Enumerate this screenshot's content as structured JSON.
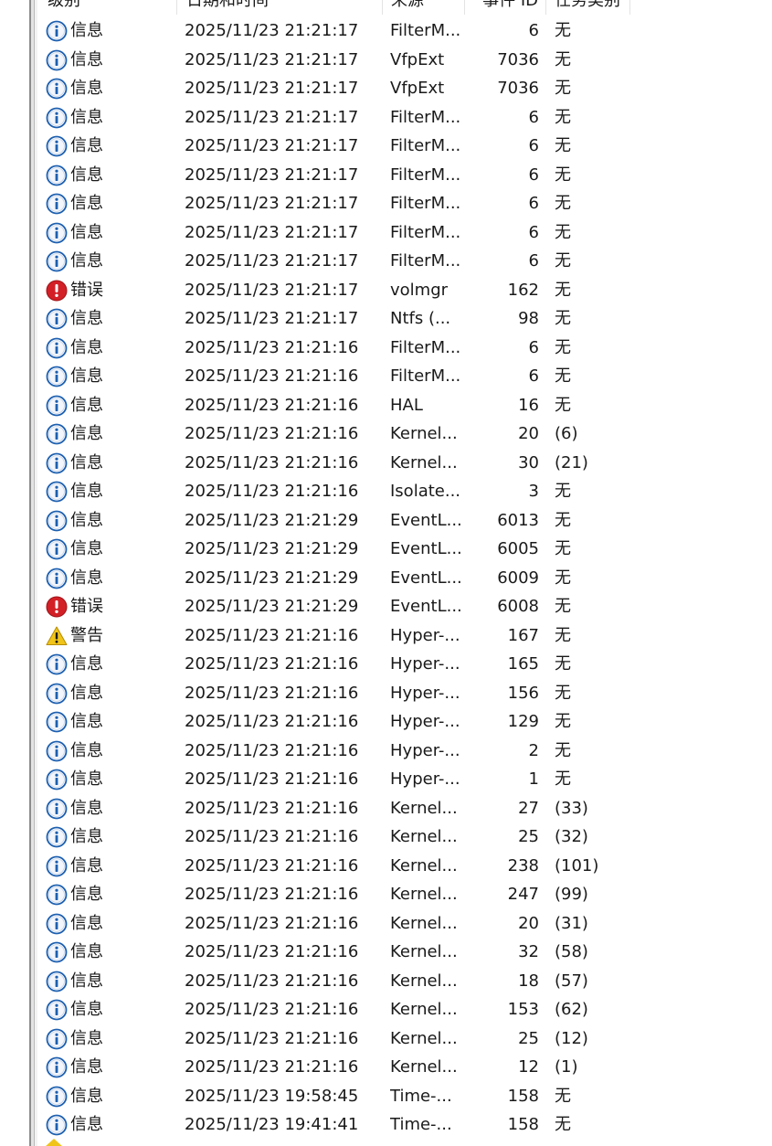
{
  "columns": {
    "level": "级别",
    "datetime": "日期和时间",
    "source": "来源",
    "event_id": "事件 ID",
    "task_category": "任务类别"
  },
  "icons": {
    "info": {
      "name": "info-icon",
      "color": "#1c5fb0"
    },
    "error": {
      "name": "error-icon",
      "color": "#d32027"
    },
    "warning": {
      "name": "warning-icon",
      "color": "#f0c419"
    }
  },
  "rows": [
    {
      "type": "info",
      "level": "信息",
      "datetime": "2025/11/23 21:21:17",
      "source": "FilterM...",
      "id": "6",
      "task": "无"
    },
    {
      "type": "info",
      "level": "信息",
      "datetime": "2025/11/23 21:21:17",
      "source": "VfpExt",
      "id": "7036",
      "task": "无"
    },
    {
      "type": "info",
      "level": "信息",
      "datetime": "2025/11/23 21:21:17",
      "source": "VfpExt",
      "id": "7036",
      "task": "无"
    },
    {
      "type": "info",
      "level": "信息",
      "datetime": "2025/11/23 21:21:17",
      "source": "FilterM...",
      "id": "6",
      "task": "无"
    },
    {
      "type": "info",
      "level": "信息",
      "datetime": "2025/11/23 21:21:17",
      "source": "FilterM...",
      "id": "6",
      "task": "无"
    },
    {
      "type": "info",
      "level": "信息",
      "datetime": "2025/11/23 21:21:17",
      "source": "FilterM...",
      "id": "6",
      "task": "无"
    },
    {
      "type": "info",
      "level": "信息",
      "datetime": "2025/11/23 21:21:17",
      "source": "FilterM...",
      "id": "6",
      "task": "无"
    },
    {
      "type": "info",
      "level": "信息",
      "datetime": "2025/11/23 21:21:17",
      "source": "FilterM...",
      "id": "6",
      "task": "无"
    },
    {
      "type": "info",
      "level": "信息",
      "datetime": "2025/11/23 21:21:17",
      "source": "FilterM...",
      "id": "6",
      "task": "无"
    },
    {
      "type": "error",
      "level": "错误",
      "datetime": "2025/11/23 21:21:17",
      "source": "volmgr",
      "id": "162",
      "task": "无"
    },
    {
      "type": "info",
      "level": "信息",
      "datetime": "2025/11/23 21:21:17",
      "source": "Ntfs (...",
      "id": "98",
      "task": "无"
    },
    {
      "type": "info",
      "level": "信息",
      "datetime": "2025/11/23 21:21:16",
      "source": "FilterM...",
      "id": "6",
      "task": "无"
    },
    {
      "type": "info",
      "level": "信息",
      "datetime": "2025/11/23 21:21:16",
      "source": "FilterM...",
      "id": "6",
      "task": "无"
    },
    {
      "type": "info",
      "level": "信息",
      "datetime": "2025/11/23 21:21:16",
      "source": "HAL",
      "id": "16",
      "task": "无"
    },
    {
      "type": "info",
      "level": "信息",
      "datetime": "2025/11/23 21:21:16",
      "source": "Kernel...",
      "id": "20",
      "task": "(6)"
    },
    {
      "type": "info",
      "level": "信息",
      "datetime": "2025/11/23 21:21:16",
      "source": "Kernel...",
      "id": "30",
      "task": "(21)"
    },
    {
      "type": "info",
      "level": "信息",
      "datetime": "2025/11/23 21:21:16",
      "source": "Isolate...",
      "id": "3",
      "task": "无"
    },
    {
      "type": "info",
      "level": "信息",
      "datetime": "2025/11/23 21:21:29",
      "source": "EventL...",
      "id": "6013",
      "task": "无"
    },
    {
      "type": "info",
      "level": "信息",
      "datetime": "2025/11/23 21:21:29",
      "source": "EventL...",
      "id": "6005",
      "task": "无"
    },
    {
      "type": "info",
      "level": "信息",
      "datetime": "2025/11/23 21:21:29",
      "source": "EventL...",
      "id": "6009",
      "task": "无"
    },
    {
      "type": "error",
      "level": "错误",
      "datetime": "2025/11/23 21:21:29",
      "source": "EventL...",
      "id": "6008",
      "task": "无"
    },
    {
      "type": "warning",
      "level": "警告",
      "datetime": "2025/11/23 21:21:16",
      "source": "Hyper-...",
      "id": "167",
      "task": "无"
    },
    {
      "type": "info",
      "level": "信息",
      "datetime": "2025/11/23 21:21:16",
      "source": "Hyper-...",
      "id": "165",
      "task": "无"
    },
    {
      "type": "info",
      "level": "信息",
      "datetime": "2025/11/23 21:21:16",
      "source": "Hyper-...",
      "id": "156",
      "task": "无"
    },
    {
      "type": "info",
      "level": "信息",
      "datetime": "2025/11/23 21:21:16",
      "source": "Hyper-...",
      "id": "129",
      "task": "无"
    },
    {
      "type": "info",
      "level": "信息",
      "datetime": "2025/11/23 21:21:16",
      "source": "Hyper-...",
      "id": "2",
      "task": "无"
    },
    {
      "type": "info",
      "level": "信息",
      "datetime": "2025/11/23 21:21:16",
      "source": "Hyper-...",
      "id": "1",
      "task": "无"
    },
    {
      "type": "info",
      "level": "信息",
      "datetime": "2025/11/23 21:21:16",
      "source": "Kernel...",
      "id": "27",
      "task": "(33)"
    },
    {
      "type": "info",
      "level": "信息",
      "datetime": "2025/11/23 21:21:16",
      "source": "Kernel...",
      "id": "25",
      "task": "(32)"
    },
    {
      "type": "info",
      "level": "信息",
      "datetime": "2025/11/23 21:21:16",
      "source": "Kernel...",
      "id": "238",
      "task": "(101)"
    },
    {
      "type": "info",
      "level": "信息",
      "datetime": "2025/11/23 21:21:16",
      "source": "Kernel...",
      "id": "247",
      "task": "(99)"
    },
    {
      "type": "info",
      "level": "信息",
      "datetime": "2025/11/23 21:21:16",
      "source": "Kernel...",
      "id": "20",
      "task": "(31)"
    },
    {
      "type": "info",
      "level": "信息",
      "datetime": "2025/11/23 21:21:16",
      "source": "Kernel...",
      "id": "32",
      "task": "(58)"
    },
    {
      "type": "info",
      "level": "信息",
      "datetime": "2025/11/23 21:21:16",
      "source": "Kernel...",
      "id": "18",
      "task": "(57)"
    },
    {
      "type": "info",
      "level": "信息",
      "datetime": "2025/11/23 21:21:16",
      "source": "Kernel...",
      "id": "153",
      "task": "(62)"
    },
    {
      "type": "info",
      "level": "信息",
      "datetime": "2025/11/23 21:21:16",
      "source": "Kernel...",
      "id": "25",
      "task": "(12)"
    },
    {
      "type": "info",
      "level": "信息",
      "datetime": "2025/11/23 21:21:16",
      "source": "Kernel...",
      "id": "12",
      "task": "(1)"
    },
    {
      "type": "info",
      "level": "信息",
      "datetime": "2025/11/23 19:58:45",
      "source": "Time-...",
      "id": "158",
      "task": "无"
    },
    {
      "type": "info",
      "level": "信息",
      "datetime": "2025/11/23 19:41:41",
      "source": "Time-...",
      "id": "158",
      "task": "无"
    }
  ]
}
